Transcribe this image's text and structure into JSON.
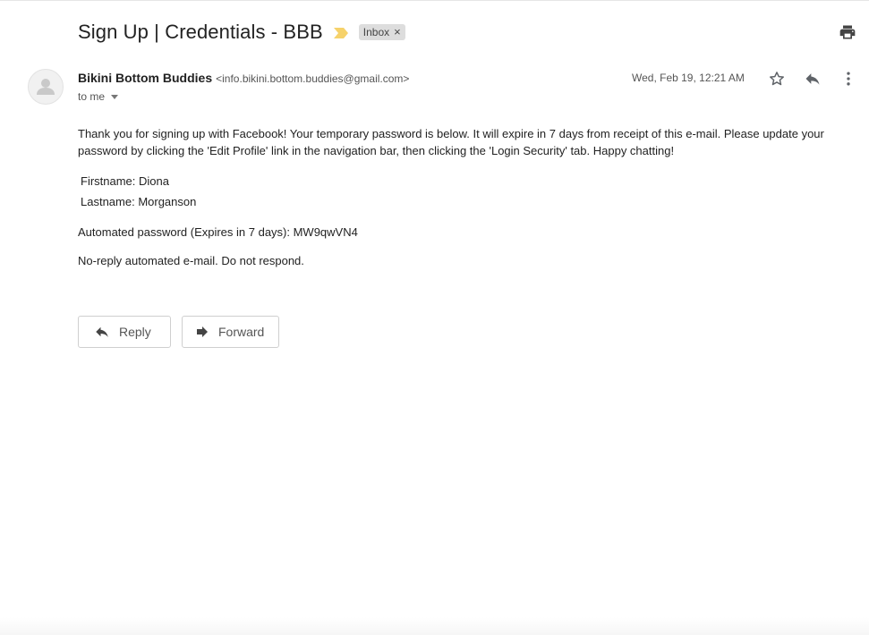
{
  "email": {
    "subject": "Sign Up | Credentials - BBB",
    "label": "Inbox",
    "label_remove": "×",
    "sender_name": "Bikini Bottom Buddies",
    "sender_email": "<info.bikini.bottom.buddies@gmail.com>",
    "recipient": "to me",
    "date": "Wed, Feb 19, 12:21 AM",
    "body_paragraph": "Thank you for signing up with Facebook! Your temporary password is below. It will expire in 7 days from receipt of this e-mail. Please update your password by clicking the 'Edit Profile' link in the navigation bar, then clicking the 'Login Security' tab. Happy chatting!",
    "firstname": "Firstname: Diona",
    "lastname": "Lastname: Morganson",
    "password_line": "Automated password (Expires in 7 days): MW9qwVN4",
    "noreply": "No-reply automated e-mail. Do not respond."
  },
  "actions": {
    "reply_label": "Reply",
    "forward_label": "Forward"
  },
  "icons": {
    "importance": "importance-marker-icon",
    "print": "print-icon",
    "star": "star-icon",
    "reply": "reply-icon",
    "more": "more-vert-icon",
    "forward": "forward-icon",
    "avatar": "default-avatar-icon"
  },
  "colors": {
    "importance_marker": "#f6d26b",
    "label_chip_bg": "#dddddd",
    "icon_gray": "#5f6368"
  }
}
